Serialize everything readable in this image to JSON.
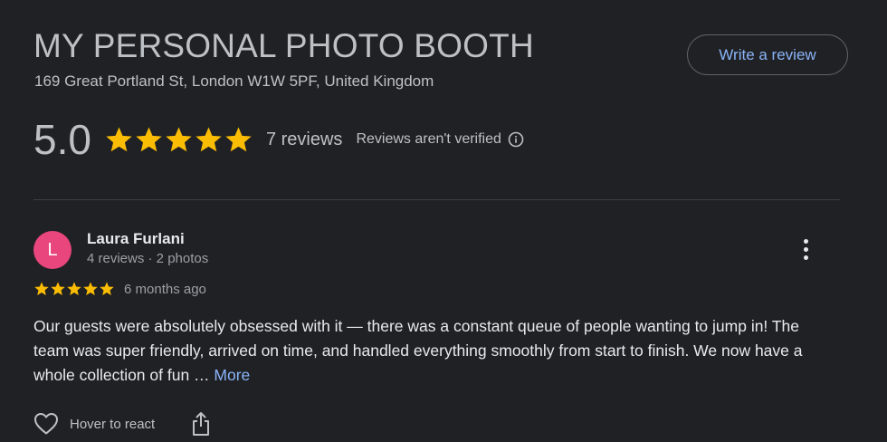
{
  "header": {
    "title": "MY PERSONAL PHOTO BOOTH",
    "address": "169 Great Portland St, London W1W 5PF, United Kingdom",
    "write_review_label": "Write a review"
  },
  "summary": {
    "rating": "5.0",
    "stars": 5,
    "review_count": "7 reviews",
    "verified_note": "Reviews aren't verified",
    "info_icon": "info-icon"
  },
  "review": {
    "avatar_letter": "L",
    "avatar_color": "#e8467c",
    "author": "Laura Furlani",
    "meta": "4 reviews · 2 photos",
    "stars": 5,
    "date": "6 months ago",
    "text": "Our guests were absolutely obsessed with it — there was a constant queue of people wanting to jump in! The team was super friendly, arrived on time, and handled everything smoothly from start to finish. We now have a whole collection of fun … ",
    "more_label": "More",
    "react_label": "Hover to react",
    "react_icon": "heart-icon",
    "share_icon": "share-icon",
    "menu_icon": "more-vert-icon"
  },
  "colors": {
    "background": "#202124",
    "star": "#fbbc04",
    "link": "#8ab4f8"
  }
}
